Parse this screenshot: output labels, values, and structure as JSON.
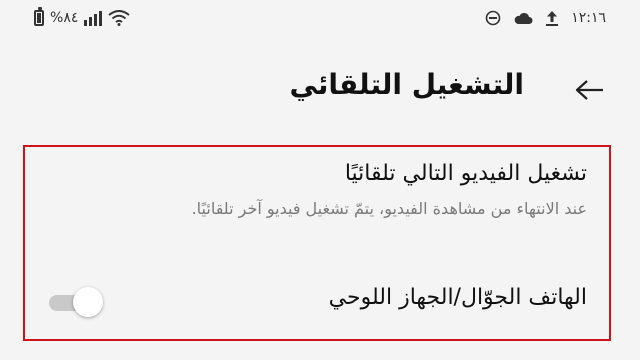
{
  "status_bar": {
    "battery_text": "%٨٤",
    "time": "١٢:١٦",
    "icons": [
      "battery-icon",
      "signal-icon",
      "wifi-icon",
      "dnd-icon",
      "cloud-icon",
      "upload-icon"
    ]
  },
  "header": {
    "title": "التشغيل التلقائي",
    "back_icon": "arrow-right-icon"
  },
  "setting": {
    "title": "تشغيل الفيديو التالي تلقائيًا",
    "description": "عند الانتهاء من مشاهدة الفيديو، يتمّ تشغيل فيديو آخر تلقائيًا.",
    "option_label": "الهاتف الجوّال/الجهاز اللوحي",
    "toggle_state": "off"
  },
  "colors": {
    "highlight_border": "#d0121b",
    "background": "#f4f4f4",
    "toggle_off": "#c9c9c9"
  }
}
